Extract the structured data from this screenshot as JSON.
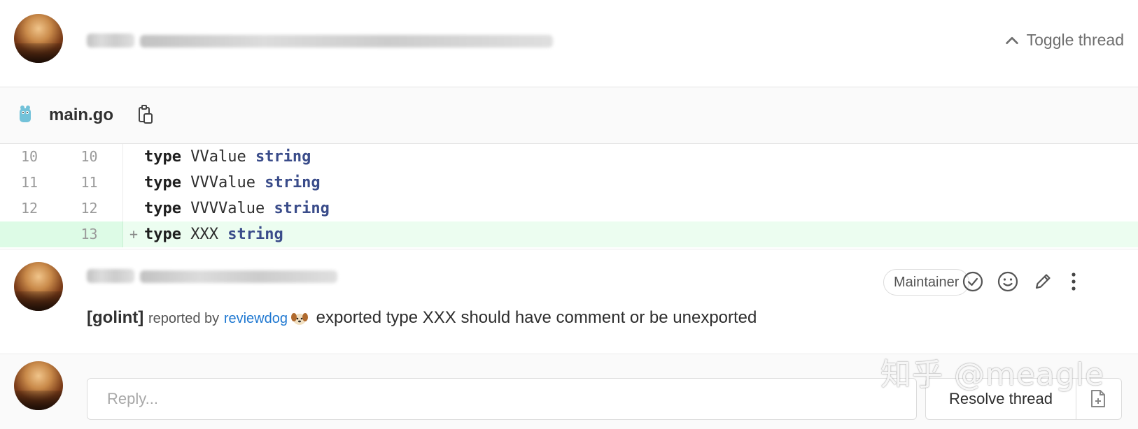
{
  "thread": {
    "toggle_label": "Toggle thread"
  },
  "file": {
    "name": "main.go"
  },
  "code_lines": [
    {
      "old": "10",
      "new": "10",
      "marker": "",
      "keyword": "type",
      "name": " VValue ",
      "type": "string",
      "added": false
    },
    {
      "old": "11",
      "new": "11",
      "marker": "",
      "keyword": "type",
      "name": " VVValue ",
      "type": "string",
      "added": false
    },
    {
      "old": "12",
      "new": "12",
      "marker": "",
      "keyword": "type",
      "name": " VVVValue ",
      "type": "string",
      "added": false
    },
    {
      "old": "",
      "new": "13",
      "marker": "+",
      "keyword": "type",
      "name": " XXX ",
      "type": "string",
      "added": true
    }
  ],
  "comment": {
    "role_badge": "Maintainer",
    "linter": "[golint]",
    "reported_by": "reported by",
    "reporter": "reviewdog",
    "message": "exported type XXX should have comment or be unexported"
  },
  "reply": {
    "placeholder": "Reply...",
    "resolve_label": "Resolve thread"
  },
  "watermark": "知乎 @meagle",
  "icons": {
    "toggle": "chevron-up-icon",
    "file": "go-gopher-icon",
    "copy": "copy-clipboard-icon",
    "resolve": "check-circle-icon",
    "emoji": "smiley-icon",
    "edit": "pencil-icon",
    "more": "kebab-menu-icon",
    "dog": "dog-emoji-icon",
    "new_issue": "new-issue-icon"
  }
}
